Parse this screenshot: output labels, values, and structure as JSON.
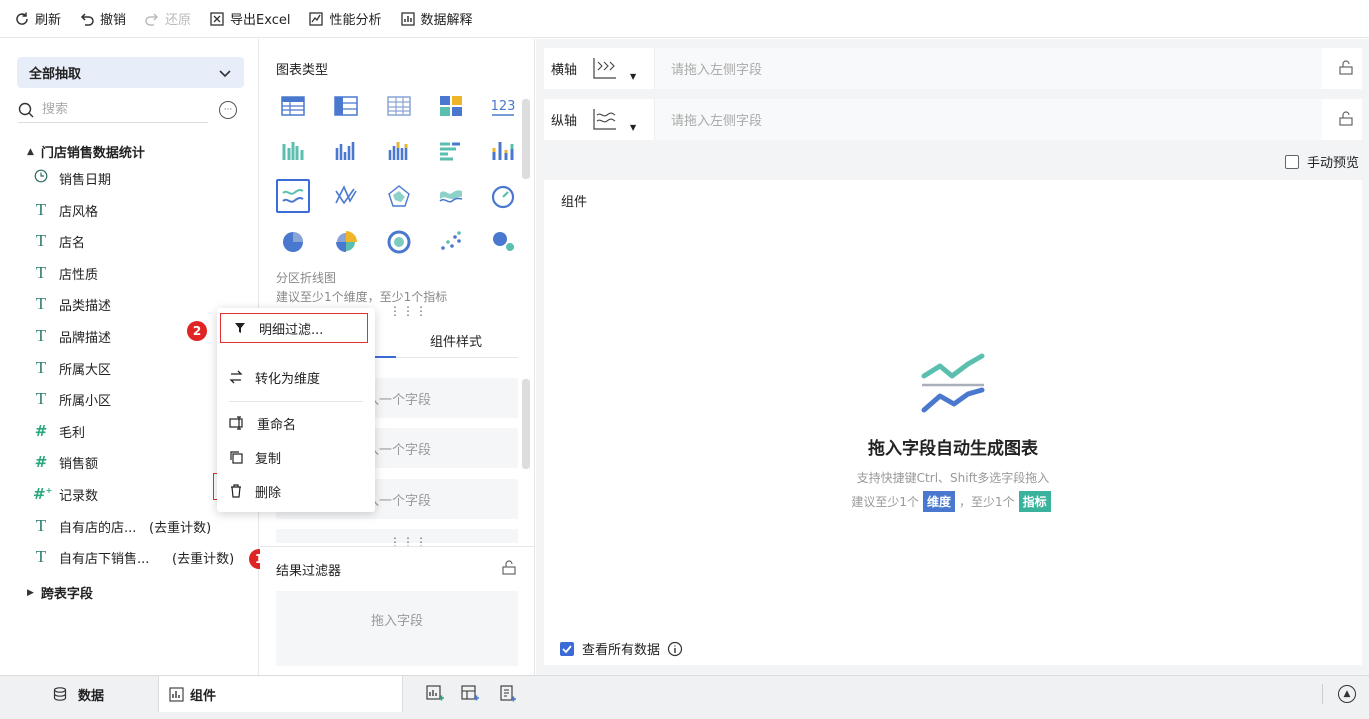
{
  "toolbar": {
    "refresh": "刷新",
    "undo": "撤销",
    "redo": "还原",
    "export_excel": "导出Excel",
    "perf_analysis": "性能分析",
    "data_explain": "数据解释"
  },
  "left": {
    "scope_select": "全部抽取",
    "search_placeholder": "搜索",
    "group_main": "门店销售数据统计",
    "group_cross": "跨表字段",
    "fields": [
      {
        "name": "销售日期",
        "type": "date"
      },
      {
        "name": "店风格",
        "type": "text"
      },
      {
        "name": "店名",
        "type": "text"
      },
      {
        "name": "店性质",
        "type": "text"
      },
      {
        "name": "品类描述",
        "type": "text"
      },
      {
        "name": "品牌描述",
        "type": "text"
      },
      {
        "name": "所属大区",
        "type": "text"
      },
      {
        "name": "所属小区",
        "type": "text"
      },
      {
        "name": "毛利",
        "type": "number"
      },
      {
        "name": "销售额",
        "type": "number"
      },
      {
        "name": "记录数",
        "type": "count"
      },
      {
        "name": "自有店的店...",
        "type": "text",
        "suffix": "(去重计数)"
      },
      {
        "name": "自有店下销售...",
        "type": "text",
        "suffix": "(去重计数)"
      }
    ],
    "badge1": "1",
    "badge2": "2"
  },
  "context_menu": {
    "detail_filter": "明细过滤...",
    "to_dimension": "转化为维度",
    "rename": "重命名",
    "copy": "复制",
    "delete": "删除"
  },
  "middle": {
    "chart_type_title": "图表类型",
    "chart_name": "分区折线图",
    "chart_hint": "建议至少1个维度，至少1个指标",
    "tab_style": "组件样式",
    "slot_text": "入一个字段",
    "result_filter": "结果过滤器",
    "drag_field": "拖入字段"
  },
  "right": {
    "x_axis_label": "横轴",
    "y_axis_label": "纵轴",
    "axis_placeholder": "请拖入左侧字段",
    "manual_preview": "手动预览",
    "canvas_title": "组件",
    "empty_title": "拖入字段自动生成图表",
    "empty_sub": "支持快捷键Ctrl、Shift多选字段拖入",
    "hint_prefix": "建议至少1个",
    "hint_dim": "维度",
    "hint_mid": "，至少1个",
    "hint_metric": "指标",
    "view_all": "查看所有数据"
  },
  "bottom": {
    "tab_data": "数据",
    "tab_component": "组件"
  },
  "colors": {
    "accent": "#3a6bd6",
    "highlight_red": "#e03030",
    "dim_tag": "#4a78cf",
    "metric_tag": "#3bb29c"
  }
}
